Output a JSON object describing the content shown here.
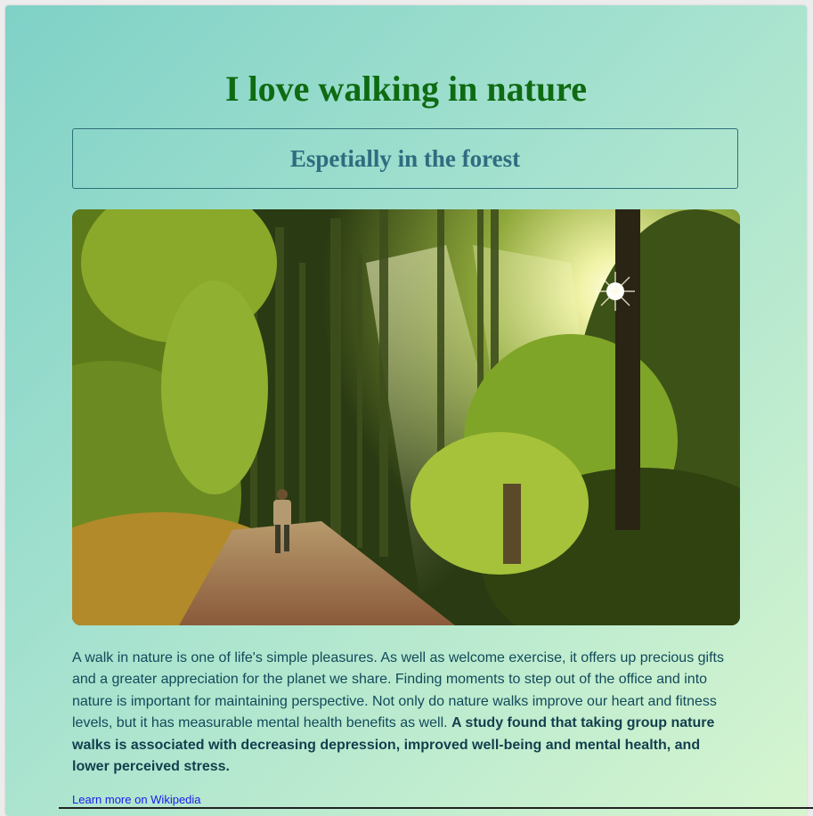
{
  "page": {
    "title": "I love walking in nature",
    "subtitle": "Espetially in the forest",
    "image": {
      "description_icon": "forest-path-photo"
    },
    "paragraph_text": "A walk in nature is one of life's simple pleasures. As well as welcome exercise, it offers up precious gifts and a greater appreciation for the planet we share. Finding moments to step out of the office and into nature is important for maintaining perspective. Not only do nature walks improve our heart and fitness levels, but it has measurable mental health benefits as well. ",
    "paragraph_bold": "A study found that taking group nature walks is associated with decreasing depression, improved well-being and mental health, and lower perceived stress.",
    "link_label": "Learn more on Wikipedia"
  },
  "colors": {
    "title": "#0f6b12",
    "subtitle": "#2f6c80",
    "text": "#124a5a",
    "link": "#1a1aee",
    "gradient_start": "#7fd1c7",
    "gradient_end": "#d6f5cf"
  }
}
